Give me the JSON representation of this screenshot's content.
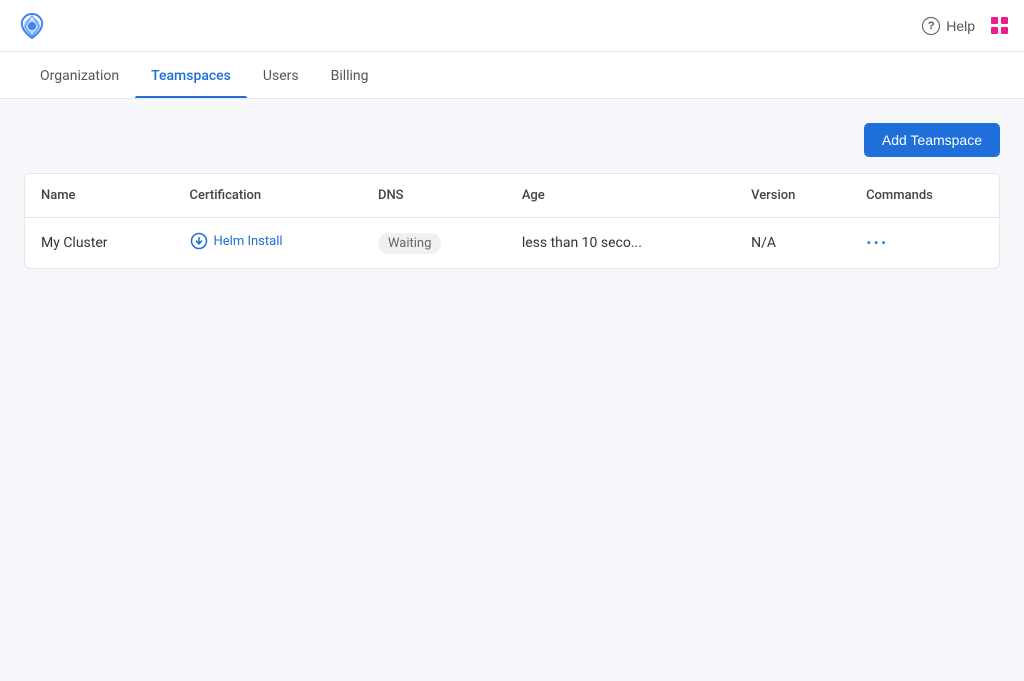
{
  "topbar": {
    "logo_alt": "App Logo",
    "help_label": "Help",
    "grid_icon_alt": "menu-icon"
  },
  "tabs": {
    "items": [
      {
        "id": "organization",
        "label": "Organization",
        "active": false
      },
      {
        "id": "teamspaces",
        "label": "Teamspaces",
        "active": true
      },
      {
        "id": "users",
        "label": "Users",
        "active": false
      },
      {
        "id": "billing",
        "label": "Billing",
        "active": false
      }
    ]
  },
  "toolbar": {
    "add_button_label": "Add Teamspace"
  },
  "table": {
    "columns": [
      {
        "id": "name",
        "label": "Name"
      },
      {
        "id": "certification",
        "label": "Certification"
      },
      {
        "id": "dns",
        "label": "DNS"
      },
      {
        "id": "age",
        "label": "Age"
      },
      {
        "id": "version",
        "label": "Version"
      },
      {
        "id": "commands",
        "label": "Commands"
      }
    ],
    "rows": [
      {
        "name": "My Cluster",
        "certification_label": "Helm Install",
        "dns_status": "Waiting",
        "age": "less than 10 seco...",
        "version": "N/A",
        "commands_icon": "···"
      }
    ]
  }
}
